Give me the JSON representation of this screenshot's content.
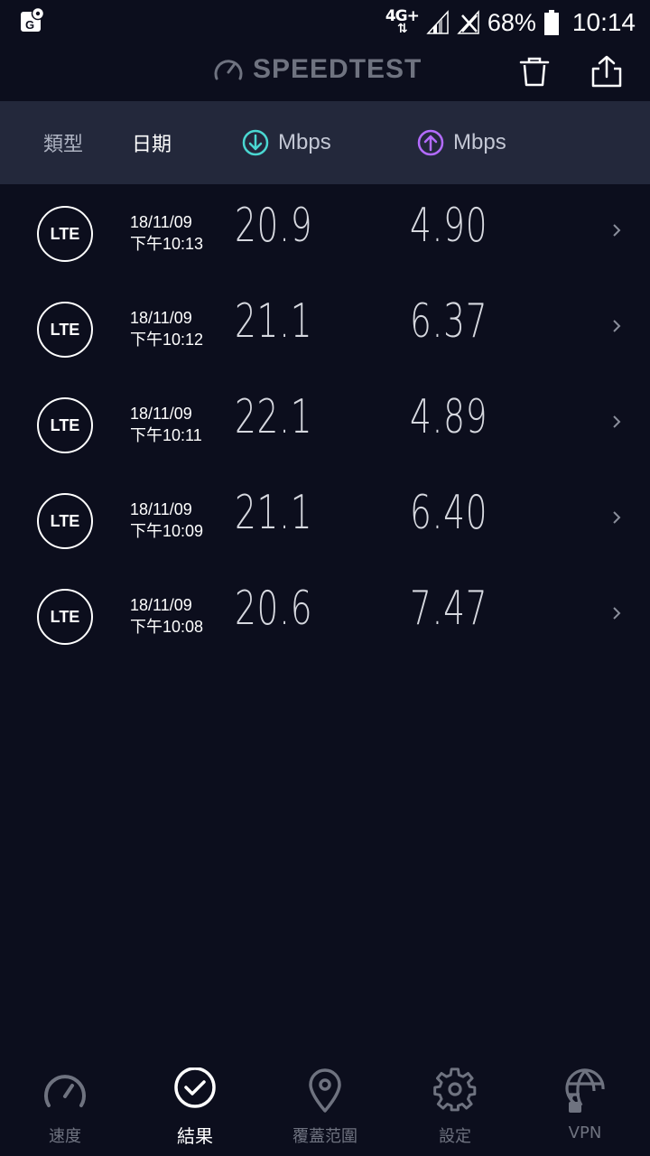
{
  "status_bar": {
    "network": "4G+",
    "battery": "68%",
    "time": "10:14"
  },
  "header": {
    "title": "SPEEDTEST"
  },
  "columns": {
    "type": "類型",
    "date": "日期",
    "download": "Mbps",
    "upload": "Mbps"
  },
  "colors": {
    "download_accent": "#4ad7d1",
    "upload_accent": "#b36bff",
    "background": "#0c0e1d",
    "header_bar": "#23283b"
  },
  "results": [
    {
      "type": "LTE",
      "date": "18/11/09",
      "time": "下午10:13",
      "download": "20.9",
      "upload": "4.90"
    },
    {
      "type": "LTE",
      "date": "18/11/09",
      "time": "下午10:12",
      "download": "21.1",
      "upload": "6.37"
    },
    {
      "type": "LTE",
      "date": "18/11/09",
      "time": "下午10:11",
      "download": "22.1",
      "upload": "4.89"
    },
    {
      "type": "LTE",
      "date": "18/11/09",
      "time": "下午10:09",
      "download": "21.1",
      "upload": "6.40"
    },
    {
      "type": "LTE",
      "date": "18/11/09",
      "time": "下午10:08",
      "download": "20.6",
      "upload": "7.47"
    }
  ],
  "nav": {
    "items": [
      {
        "label": "速度",
        "icon": "speedometer-icon"
      },
      {
        "label": "結果",
        "icon": "check-circle-icon",
        "active": true
      },
      {
        "label": "覆蓋范圍",
        "icon": "map-pin-icon"
      },
      {
        "label": "設定",
        "icon": "gear-icon"
      },
      {
        "label": "VPN",
        "icon": "globe-lock-icon"
      }
    ]
  }
}
